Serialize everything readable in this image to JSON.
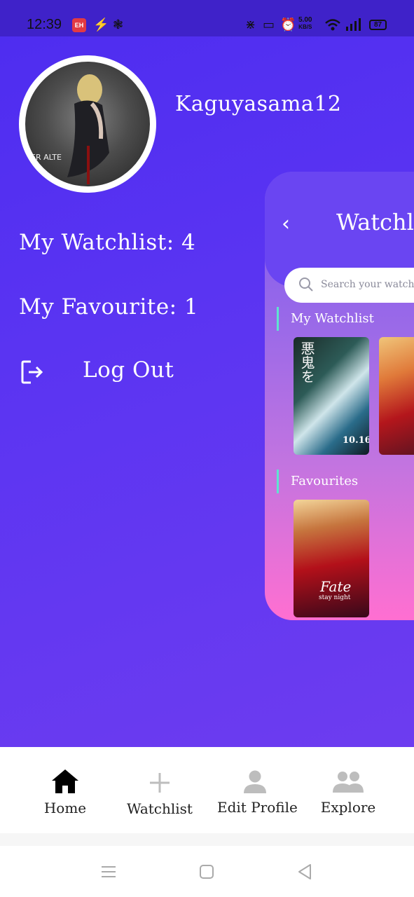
{
  "status_bar": {
    "time": "12:39",
    "app_badge": "EH",
    "net_speed_value": "5.00",
    "net_speed_unit": "KB/S",
    "battery": "87"
  },
  "profile": {
    "username": "Kaguyasama12",
    "watchlist_label": "My Watchlist: 4",
    "favourite_label": "My Favourite: 1",
    "logout_label": "Log Out"
  },
  "preview": {
    "title": "Watchlist",
    "search_placeholder": "Search your watchlist",
    "watchlist_section": "My Watchlist",
    "favourites_section": "Favourites"
  },
  "bottom_nav": {
    "items": [
      {
        "label": "Home",
        "icon": "home-icon"
      },
      {
        "label": "Watchlist",
        "icon": "plus-icon"
      },
      {
        "label": "Edit Profile",
        "icon": "person-icon"
      },
      {
        "label": "Explore",
        "icon": "group-icon"
      }
    ]
  },
  "colors": {
    "background": "#5a34f2",
    "accent_bar": "#5fe3d0",
    "status_bar": "#3f22c9",
    "nav_background": "#ffffff"
  }
}
